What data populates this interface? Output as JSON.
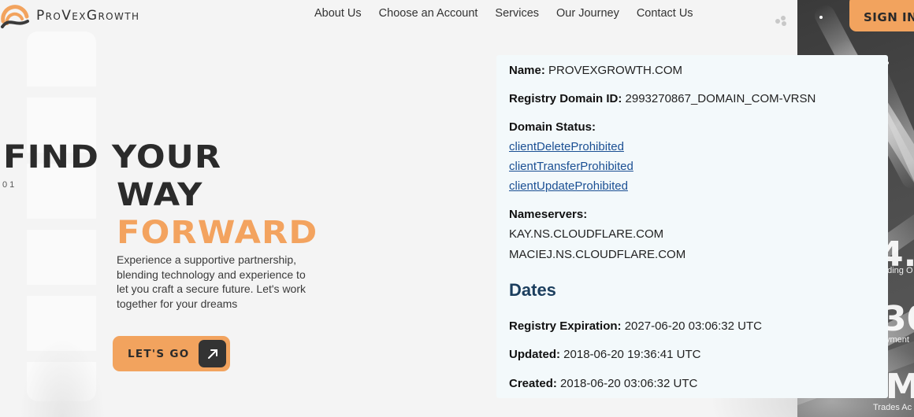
{
  "brand": {
    "name": "ProVexGrowth",
    "accent": "#f2a35e",
    "dark": "#2b2b2b"
  },
  "nav": {
    "items": [
      "About Us",
      "Choose an Account",
      "Services",
      "Our Journey",
      "Contact Us"
    ],
    "signin_label": "SIGN IN"
  },
  "hero": {
    "line1": "FIND YOUR",
    "line2": "WAY",
    "line3": "FORWARD",
    "index": "01",
    "description": "Experience a supportive partnership, blending technology and experience to let you craft a secure future. Let's work together for your dreams",
    "cta_label": "LET'S GO"
  },
  "side_stats": {
    "stat1_value": "4.",
    "stat1_caption": "ading O",
    "stat2_value": "30",
    "stat2_caption": "yment",
    "stat3_value": "M",
    "stat3_caption": "Trades Ac"
  },
  "whois": {
    "name_label": "Name:",
    "name_value": "PROVEXGROWTH.COM",
    "registry_id_label": "Registry Domain ID:",
    "registry_id_value": "2993270867_DOMAIN_COM-VRSN",
    "status_label": "Domain Status:",
    "statuses": [
      "clientDeleteProhibited",
      "clientTransferProhibited",
      "clientUpdateProhibited"
    ],
    "nameservers_label": "Nameservers:",
    "nameservers": [
      "KAY.NS.CLOUDFLARE.COM",
      "MACIEJ.NS.CLOUDFLARE.COM"
    ],
    "dates_heading": "Dates",
    "expiration_label": "Registry Expiration:",
    "expiration_value": "2027-06-20 03:06:32 UTC",
    "updated_label": "Updated:",
    "updated_value": "2018-06-20 19:36:41 UTC",
    "created_label": "Created:",
    "created_value": "2018-06-20 03:06:32 UTC"
  }
}
